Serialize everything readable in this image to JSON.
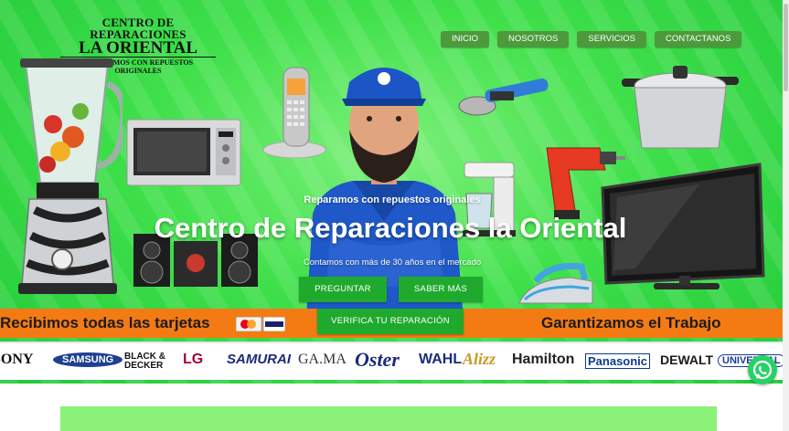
{
  "logo": {
    "line1": "CENTRO DE REPARACIONES",
    "line2": "LA ORIENTAL",
    "line3": "REPARAMOS CON REPUESTOS ORIGINALES"
  },
  "nav": {
    "items": [
      "INICIO",
      "NOSOTROS",
      "SERVICIOS",
      "CONTACTANOS"
    ]
  },
  "hero": {
    "subtitle": "Reparamos con repuestos originales",
    "title": "Centro de Reparaciones la Oriental",
    "tagline": "Contamos con más de 30 años en el mercado",
    "buttons": {
      "preguntar": "PREGUNTAR",
      "saber": "SABER MÁS",
      "verifica": "VERIFICA TU REPARACIÓN"
    }
  },
  "banner": {
    "left": "Recibimos todas las tarjetas",
    "right": "Garantizamos el Trabajo"
  },
  "brands": [
    "SONY",
    "SAMSUNG",
    "BLACK & DECKER",
    "LG",
    "SAMURAI",
    "GA.MA",
    "Oster",
    "WAHL",
    "Alizz",
    "Hamilton",
    "Panasonic",
    "DEWALT",
    "UNIVERSAL"
  ],
  "icons": {
    "whatsapp": "whatsapp-icon",
    "cards": "credit-cards-icon"
  },
  "colors": {
    "hero_green": "#3fe04a",
    "nav_green": "#4c9a3c",
    "button_green": "#1faa2e",
    "banner_orange": "#f47b14"
  }
}
